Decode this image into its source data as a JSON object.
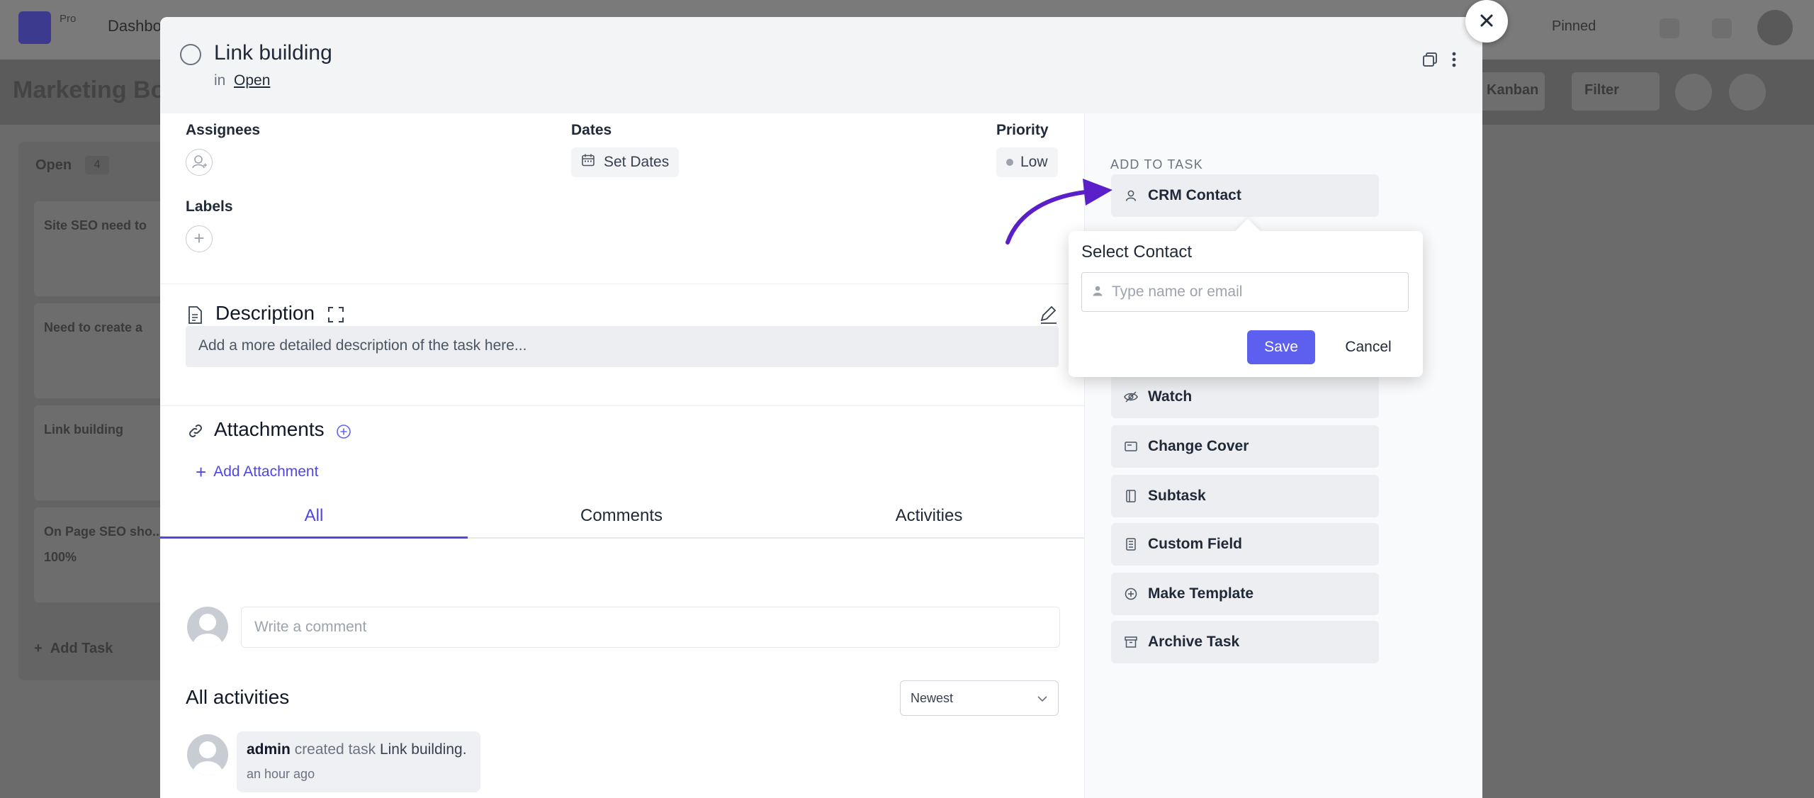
{
  "background": {
    "logo_text": "Pro",
    "nav_item": "Dashboa",
    "pinned": "Pinned",
    "board_title": "Marketing Boa",
    "view_label": "Kanban",
    "filter_label": "Filter",
    "column": {
      "title": "Open",
      "count": "4"
    },
    "cards": [
      "Site SEO need to",
      "Need to create a",
      "Link building",
      "On Page SEO sho... 100%"
    ],
    "add_task": "Add Task"
  },
  "task": {
    "title": "Link building",
    "in_label": "in",
    "stage": "Open"
  },
  "fields": {
    "assignees_label": "Assignees",
    "dates_label": "Dates",
    "set_dates": "Set Dates",
    "priority_label": "Priority",
    "priority_value": "Low",
    "labels_label": "Labels"
  },
  "description": {
    "title": "Description",
    "placeholder": "Add a more detailed description of the task here..."
  },
  "attachments": {
    "title": "Attachments",
    "add": "Add Attachment"
  },
  "tabs": [
    "All",
    "Comments",
    "Activities"
  ],
  "comment": {
    "placeholder": "Write a comment"
  },
  "activities": {
    "title": "All activities",
    "sort": "Newest",
    "items": [
      {
        "user": "admin",
        "verb": "created task",
        "object": "Link building.",
        "time": "an hour ago"
      }
    ]
  },
  "sidebar": {
    "heading": "ADD TO TASK",
    "items": [
      {
        "label": "CRM Contact",
        "icon": "user-icon"
      },
      {
        "label": "Watch",
        "icon": "eye-icon"
      },
      {
        "label": "Change Cover",
        "icon": "cover-icon"
      },
      {
        "label": "Subtask",
        "icon": "subtask-icon"
      },
      {
        "label": "Custom Field",
        "icon": "custom-field-icon"
      },
      {
        "label": "Make Template",
        "icon": "template-icon"
      },
      {
        "label": "Archive Task",
        "icon": "archive-icon"
      }
    ]
  },
  "popover": {
    "title": "Select Contact",
    "placeholder": "Type name or email",
    "save": "Save",
    "cancel": "Cancel"
  },
  "colors": {
    "accent": "#4f46e5",
    "save_button": "#5d5fef",
    "arrow": "#5b1fc9"
  }
}
